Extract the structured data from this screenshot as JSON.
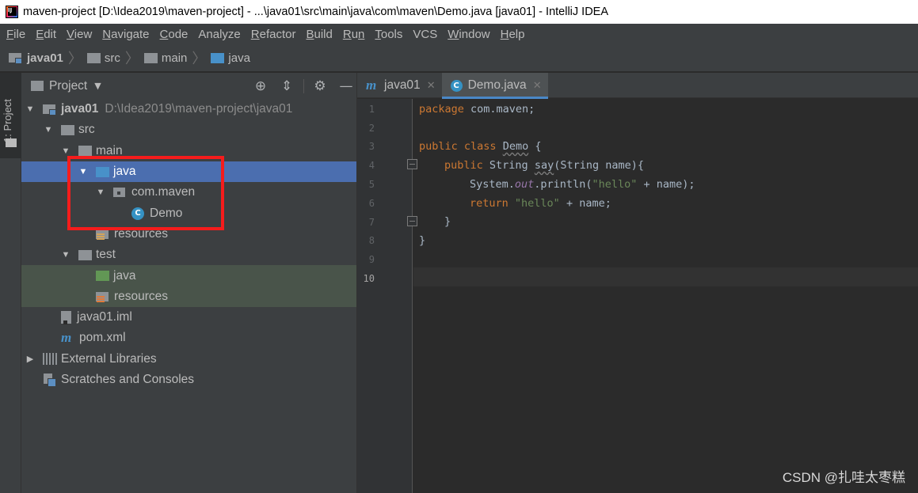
{
  "window": {
    "title": "maven-project [D:\\Idea2019\\maven-project] - ...\\java01\\src\\main\\java\\com\\maven\\Demo.java [java01] - IntelliJ IDEA"
  },
  "menu": [
    {
      "underline": "F",
      "rest": "ile"
    },
    {
      "underline": "E",
      "rest": "dit"
    },
    {
      "underline": "V",
      "rest": "iew"
    },
    {
      "underline": "N",
      "rest": "avigate"
    },
    {
      "underline": "C",
      "rest": "ode"
    },
    {
      "underline": "",
      "rest": "Analyze"
    },
    {
      "underline": "R",
      "rest": "efactor"
    },
    {
      "underline": "B",
      "rest": "uild"
    },
    {
      "underline": "R",
      "rest": "u",
      "tail": "n"
    },
    {
      "underline": "T",
      "rest": "ools"
    },
    {
      "underline": "",
      "rest": "VCS"
    },
    {
      "underline": "W",
      "rest": "indow"
    },
    {
      "underline": "H",
      "rest": "elp"
    }
  ],
  "breadcrumb": [
    "java01",
    "src",
    "main",
    "java"
  ],
  "tool_stripe": {
    "label": "1: Project"
  },
  "project_panel": {
    "title": "Project",
    "tree": [
      {
        "label": "java01",
        "path": "D:\\Idea2019\\maven-project\\java01"
      },
      {
        "label": "src"
      },
      {
        "label": "main"
      },
      {
        "label": "java"
      },
      {
        "label": "com.maven"
      },
      {
        "label": "Demo"
      },
      {
        "label": "resources"
      },
      {
        "label": "test"
      },
      {
        "label": "java"
      },
      {
        "label": "resources"
      },
      {
        "label": "java01.iml"
      },
      {
        "label": "pom.xml"
      },
      {
        "label": "External Libraries"
      },
      {
        "label": "Scratches and Consoles"
      }
    ]
  },
  "tabs": [
    {
      "label": "java01",
      "active": false
    },
    {
      "label": "Demo.java",
      "active": true
    }
  ],
  "editor": {
    "line_numbers": [
      "1",
      "2",
      "3",
      "4",
      "5",
      "6",
      "7",
      "8",
      "9",
      "10"
    ],
    "code": {
      "l1_kw": "package",
      "l1_rest": " com.maven;",
      "l3_kw": "public class",
      "l3_cls": "Demo",
      "l3_rest": " {",
      "l4_kw": "public",
      "l4_rest": " String ",
      "l4_m": "say",
      "l4_rest2": "(String name){",
      "l5_a": "System.",
      "l5_fld": "out",
      "l5_b": ".println(",
      "l5_str": "\"hello\"",
      "l5_c": " + name);",
      "l6_kw": "return",
      "l6_str": " \"hello\"",
      "l6_c": " + name;",
      "l7": "}",
      "l8": "}"
    }
  },
  "watermark": "CSDN @扎哇太枣糕"
}
